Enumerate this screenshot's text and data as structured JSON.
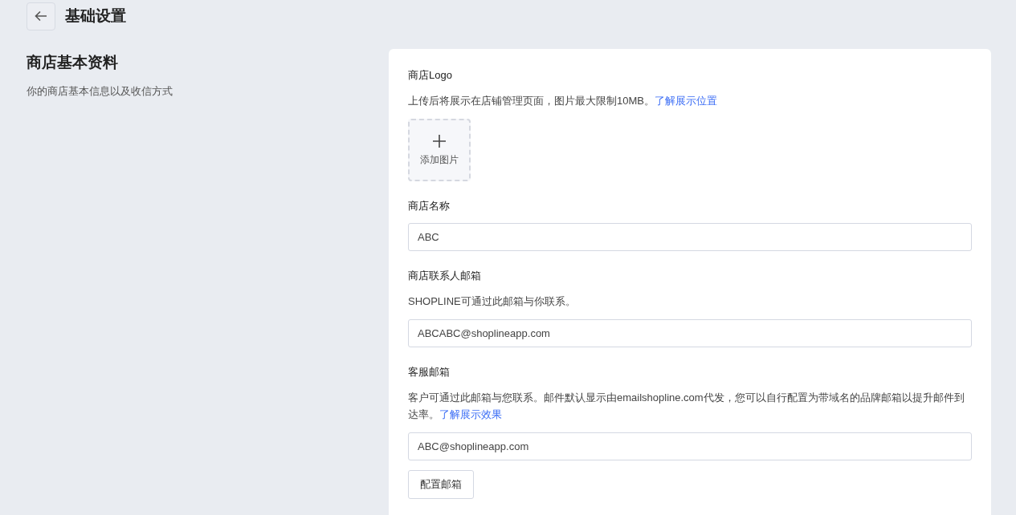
{
  "header": {
    "title": "基础设置"
  },
  "intro": {
    "title": "商店基本资料",
    "description": "你的商店基本信息以及收信方式"
  },
  "sections": [
    {
      "kind": "upload",
      "label": "商店Logo",
      "description": "上传后将展示在店铺管理页面，图片最大限制10MB。",
      "link": "了解展示位置",
      "upload_label": "添加图片"
    },
    {
      "kind": "field",
      "label": "商店名称",
      "value": "ABC"
    },
    {
      "kind": "field",
      "label": "商店联系人邮箱",
      "description": "SHOPLINE可通过此邮箱与你联系。",
      "value": "ABCABC@shoplineapp.com"
    },
    {
      "kind": "field",
      "label": "客服邮箱",
      "description": "客户可通过此邮箱与您联系。邮件默认显示由emailshopline.com代发，您可以自行配置为带域名的品牌邮箱以提升邮件到达率。",
      "link": "了解展示效果",
      "value": "ABC@shoplineapp.com",
      "button": "配置邮箱"
    }
  ]
}
